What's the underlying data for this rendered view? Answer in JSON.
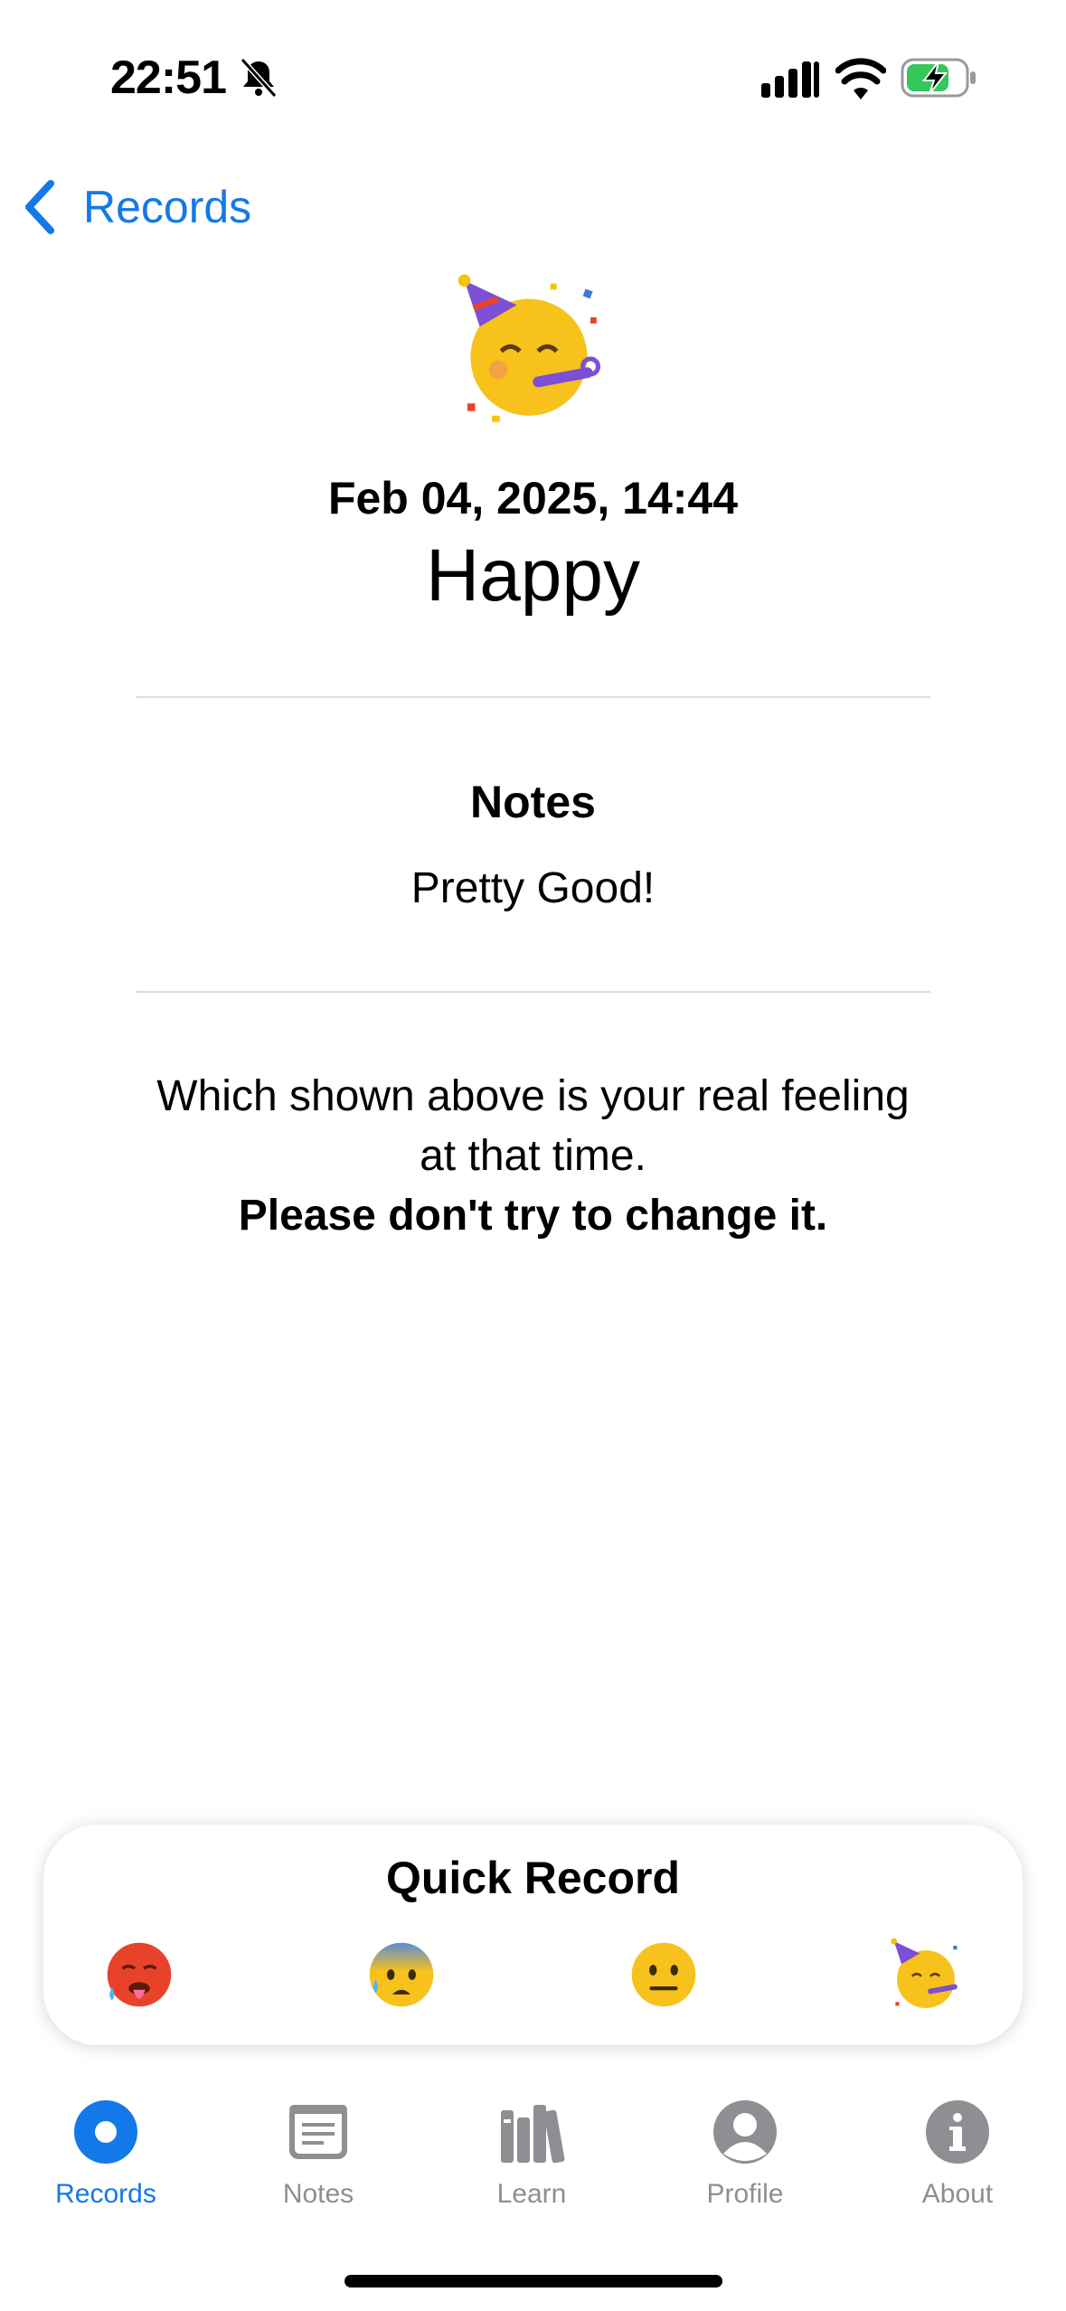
{
  "status_bar": {
    "time": "22:51",
    "silent_mode": true,
    "battery_charging": true
  },
  "nav": {
    "back_label": "Records"
  },
  "record": {
    "emoji": "partying-face",
    "date": "Feb 04, 2025, 14:44",
    "mood": "Happy"
  },
  "notes": {
    "heading": "Notes",
    "text": "Pretty Good!"
  },
  "info": {
    "line1": "Which shown above is your real feeling at that time.",
    "line2": "Please don't try to change it."
  },
  "quick_record": {
    "title": "Quick Record",
    "emojis": [
      "hot-face",
      "anxious-face-with-sweat",
      "neutral-face",
      "partying-face"
    ]
  },
  "tab_bar": {
    "active": "Records",
    "tabs": [
      {
        "label": "Records",
        "icon": "records-icon"
      },
      {
        "label": "Notes",
        "icon": "notes-icon"
      },
      {
        "label": "Learn",
        "icon": "books-icon"
      },
      {
        "label": "Profile",
        "icon": "person-icon"
      },
      {
        "label": "About",
        "icon": "info-icon"
      }
    ]
  },
  "colors": {
    "accent": "#1479e8",
    "inactive": "#8e8e93",
    "divider": "#dcdcdc",
    "emoji_yellow": "#f6c21b",
    "hot_red": "#e8432a"
  }
}
